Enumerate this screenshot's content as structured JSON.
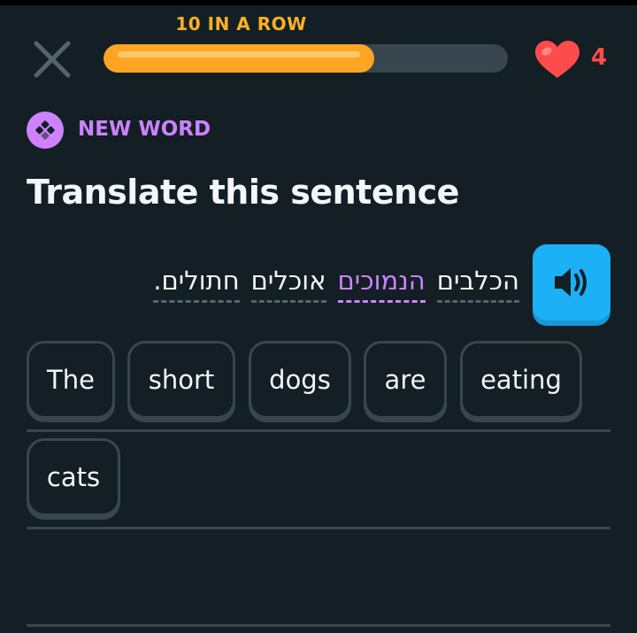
{
  "header": {
    "streak_text": "10 IN A ROW",
    "progress_percent": 67,
    "hearts": "4"
  },
  "badge": {
    "label": "NEW WORD"
  },
  "prompt": {
    "title": "Translate this sentence"
  },
  "sentence": {
    "words": [
      "הכלבים",
      "הנמוכים",
      "אוכלים",
      "חתולים."
    ],
    "new_word": "הנמוכים"
  },
  "answer_bank": {
    "chips": [
      "The",
      "short",
      "dogs",
      "are",
      "eating",
      "cats"
    ]
  },
  "colors": {
    "background": "#131f24",
    "streak": "#ffb020",
    "progress_fill": "#ffa423",
    "heart": "#ff4b4b",
    "new_word": "#ce82ff",
    "speaker": "#1cb0f6"
  }
}
